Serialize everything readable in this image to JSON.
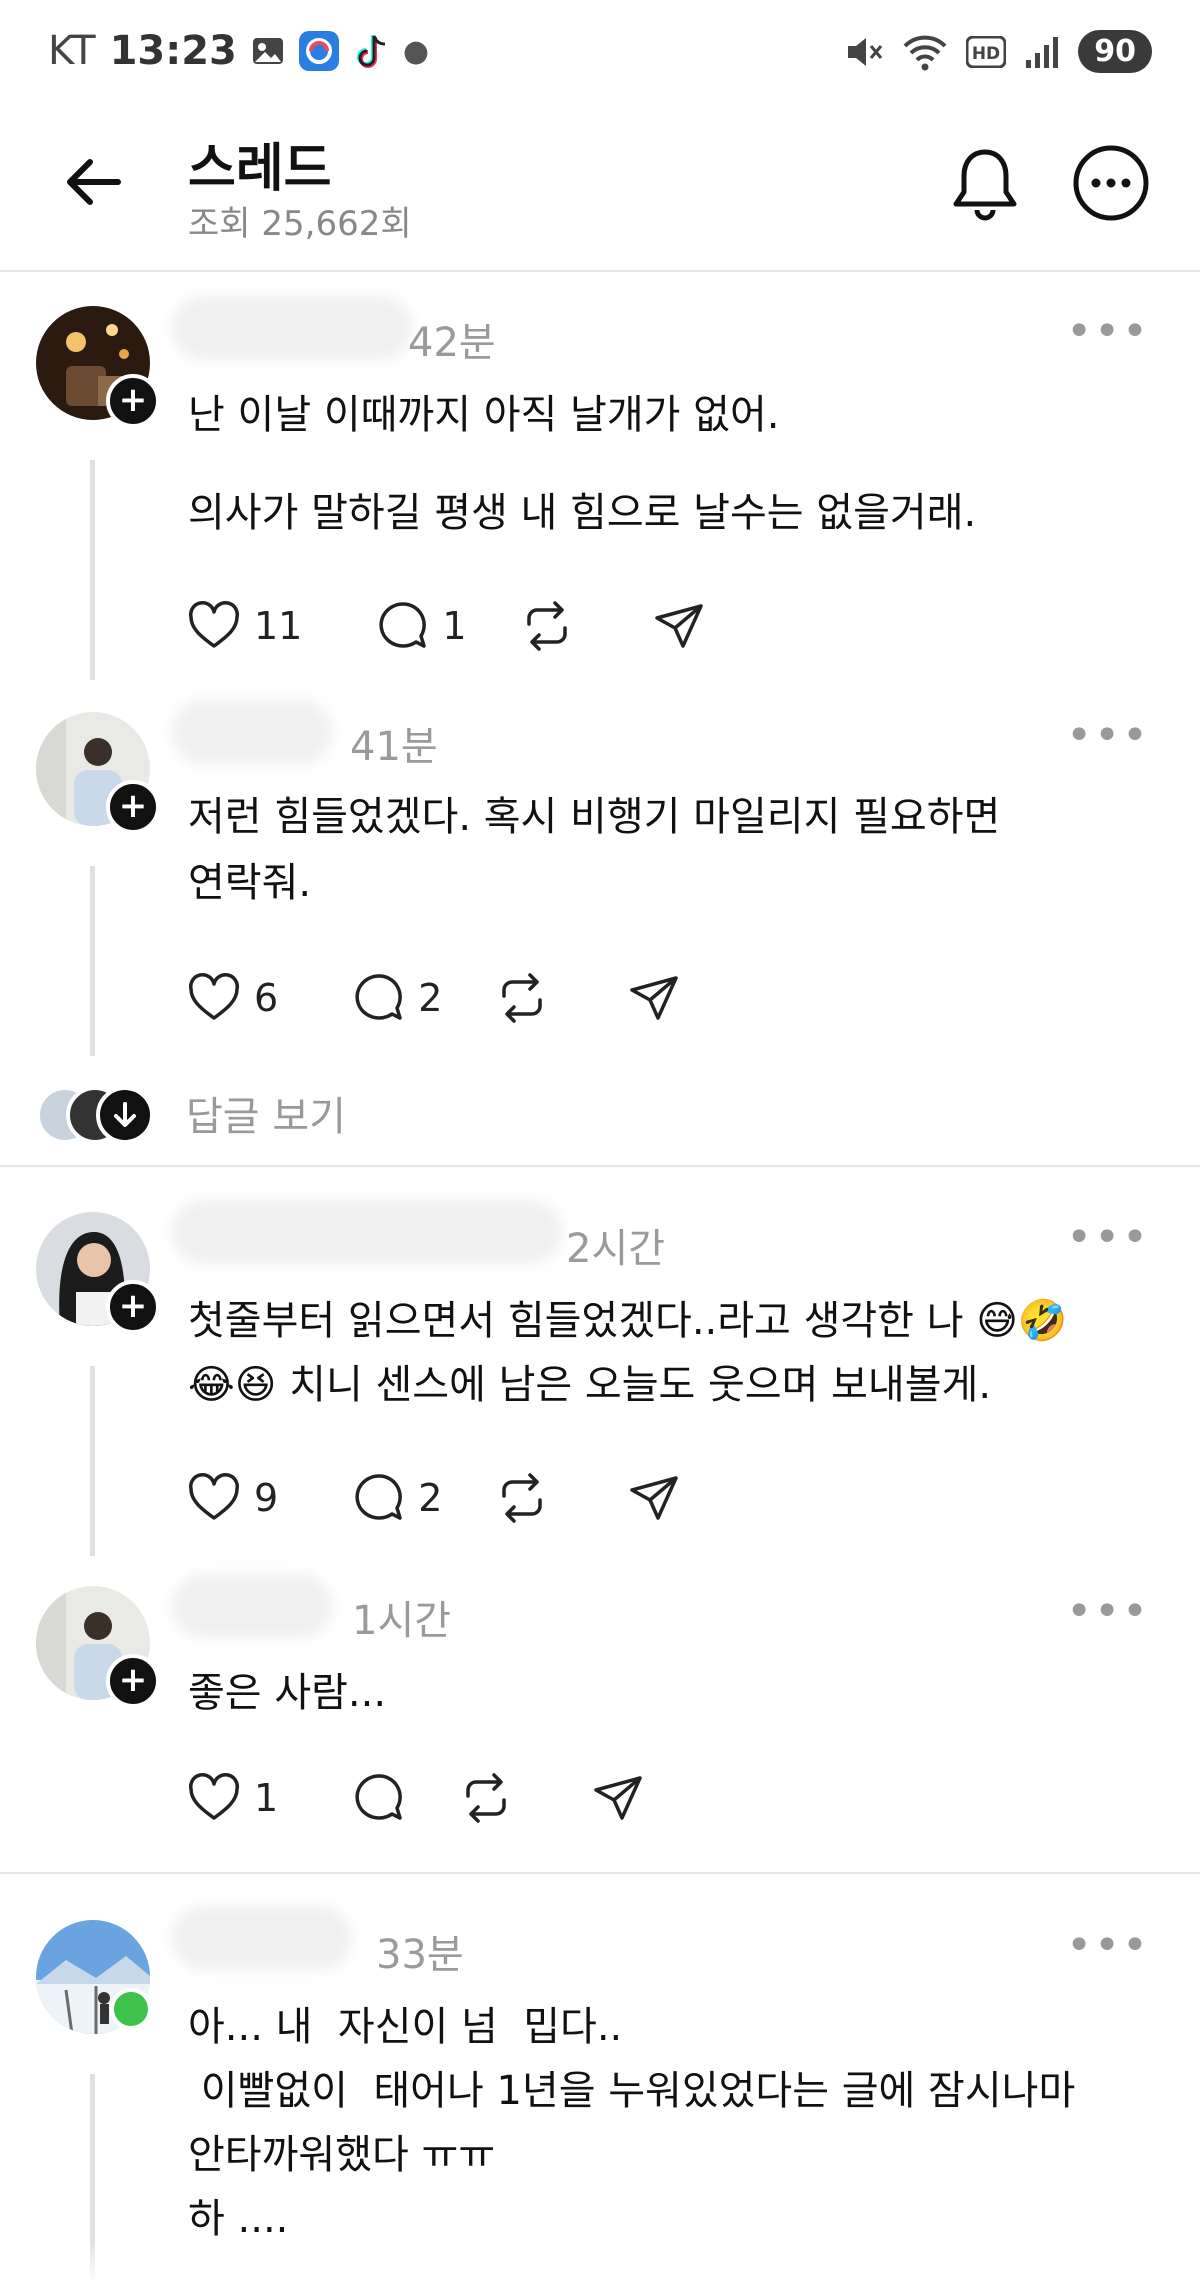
{
  "status_bar": {
    "carrier": "KT",
    "time": "13:23",
    "battery": "90",
    "left_icons": [
      "gallery-icon",
      "app-icon",
      "tiktok-icon",
      "dot-icon"
    ],
    "right_icons": [
      "mute-icon",
      "wifi-icon",
      "hd-icon",
      "signal-icon"
    ]
  },
  "header": {
    "title": "스레드",
    "views": "조회 25,662회"
  },
  "posts": [
    {
      "time": "42분",
      "lines": [
        "난 이날 이때까지 아직 날개가 없어.",
        "",
        "의사가 말하길 평생 내 힘으로 날수는 없을거래."
      ],
      "likes": "11",
      "comments": "1"
    },
    {
      "time": "41분",
      "lines": [
        "저런 힘들었겠다. 혹시 비행기 마일리지 필요하면",
        "연락줘."
      ],
      "likes": "6",
      "comments": "2"
    },
    {
      "time": "2시간",
      "lines": [
        "첫줄부터 읽으면서 힘들었겠다..라고 생각한 나 😅🤣",
        "😂😆 치니 센스에 남은 오늘도 웃으며 보내볼게."
      ],
      "likes": "9",
      "comments": "2"
    },
    {
      "time": "1시간",
      "lines": [
        "좋은 사람..."
      ],
      "likes": "1",
      "comments": ""
    },
    {
      "time": "33분",
      "lines": [
        "아... 내  자신이 넘  밉다..",
        " 이빨없이  태어나 1년을 누워있었다는 글에 잠시나마",
        "안타까워했다 ㅠㅠ",
        "하 ...."
      ],
      "likes": "",
      "comments": ""
    }
  ],
  "replies_link": "답글 보기",
  "colors": {
    "text": "#111111",
    "muted": "#9a9a9a",
    "divider": "#e6e6e6",
    "thread_line": "#e1e1e1",
    "online": "#3ec24b"
  }
}
